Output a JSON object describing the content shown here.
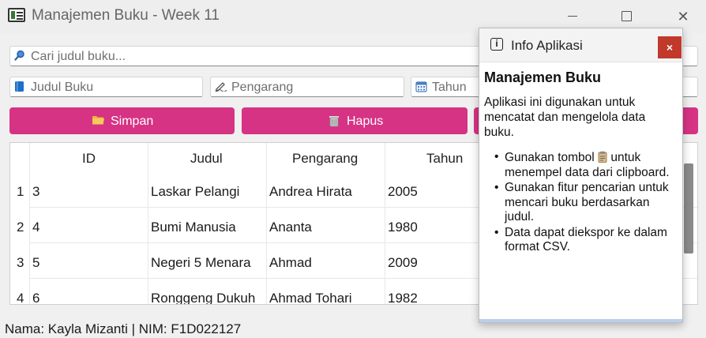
{
  "window": {
    "title": "Manajemen Buku - Week 11",
    "close_glyph": "✕"
  },
  "search": {
    "placeholder": "Cari judul buku...",
    "icon": "search-icon"
  },
  "form": {
    "judul_placeholder": "Judul Buku",
    "judul_icon": "book-icon",
    "pengarang_placeholder": "Pengarang",
    "pengarang_icon": "pen-icon",
    "tahun_placeholder": "Tahun",
    "tahun_icon": "calendar-icon"
  },
  "buttons": {
    "simpan_label": "Simpan",
    "simpan_icon": "folder-icon",
    "hapus_label": "Hapus",
    "hapus_icon": "trash-icon"
  },
  "table": {
    "columns": [
      "ID",
      "Judul",
      "Pengarang",
      "Tahun"
    ],
    "rows": [
      {
        "num": "1",
        "id": "3",
        "judul": "Laskar Pelangi",
        "pengarang": "Andrea Hirata",
        "tahun": "2005"
      },
      {
        "num": "2",
        "id": "4",
        "judul": "Bumi Manusia",
        "pengarang": "Ananta",
        "tahun": "1980"
      },
      {
        "num": "3",
        "id": "5",
        "judul": "Negeri 5 Menara",
        "pengarang": "Ahmad",
        "tahun": "2009"
      },
      {
        "num": "4",
        "id": "6",
        "judul": "Ronggeng Dukuh",
        "pengarang": "Ahmad Tohari",
        "tahun": "1982"
      }
    ]
  },
  "footer": {
    "text": "Nama: Kayla Mizanti | NIM: F1D022127"
  },
  "dialog": {
    "title": "Info Aplikasi",
    "close_label": "×",
    "heading": "Manajemen Buku",
    "paragraph": "Aplikasi ini digunakan untuk mencatat dan mengelola data buku.",
    "bullet1_a": "Gunakan tombol",
    "bullet1_b": "untuk menempel data dari clipboard.",
    "bullet2": "Gunakan fitur pencarian untuk mencari buku berdasarkan judul.",
    "bullet3": "Data dapat diekspor ke dalam format CSV."
  },
  "colors": {
    "accent": "#d63384",
    "close_button": "#c0392b",
    "window_bg": "#f0f0f0"
  }
}
